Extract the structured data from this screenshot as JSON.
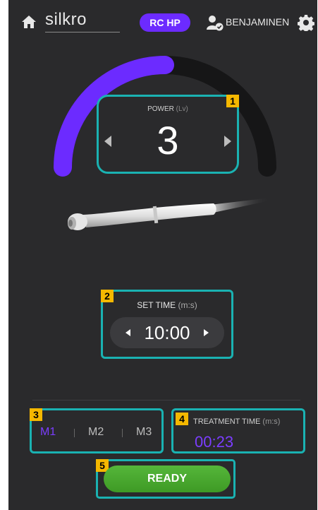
{
  "header": {
    "logo": "silkro",
    "mode_badge": "RC HP",
    "user_name": "BENJAMINEN",
    "icons": [
      "home-icon",
      "user-check-icon",
      "gear-icon"
    ]
  },
  "power": {
    "label": "POWER",
    "unit": "(Lv)",
    "value": "3",
    "gauge_fraction": 0.5,
    "badge": "1"
  },
  "set_time": {
    "label": "SET TIME",
    "unit": "(m:s)",
    "value": "10:00",
    "badge": "2"
  },
  "modes": {
    "badge": "3",
    "items": [
      "M1",
      "M2",
      "M3"
    ],
    "active": "M1"
  },
  "treatment_time": {
    "badge": "4",
    "label": "TREATMENT TIME",
    "unit": "(m:s)",
    "value": "00:23"
  },
  "ready": {
    "badge": "5",
    "label": "READY"
  },
  "colors": {
    "accent": "#6c2bff",
    "frame": "#1ab2b2",
    "badge": "#f5b800",
    "ready": "#4aa82e",
    "background": "#2a2a2c"
  }
}
